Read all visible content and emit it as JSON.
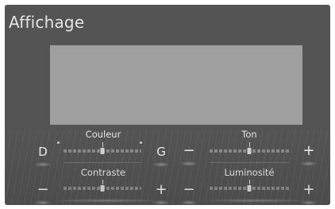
{
  "screen": {
    "title": "Affichage"
  },
  "sliders": {
    "couleur": {
      "label": "Couleur",
      "left_label": "D",
      "right_label": "G",
      "value": 0.5
    },
    "ton": {
      "label": "Ton",
      "left_label": "−",
      "right_label": "+",
      "value": 0.5
    },
    "contraste": {
      "label": "Contraste",
      "left_label": "−",
      "right_label": "+",
      "value": 0.5
    },
    "luminosite": {
      "label": "Luminosité",
      "left_label": "−",
      "right_label": "+",
      "value": 0.5
    }
  },
  "icons": {
    "minus": "minus-icon",
    "plus": "plus-icon"
  }
}
